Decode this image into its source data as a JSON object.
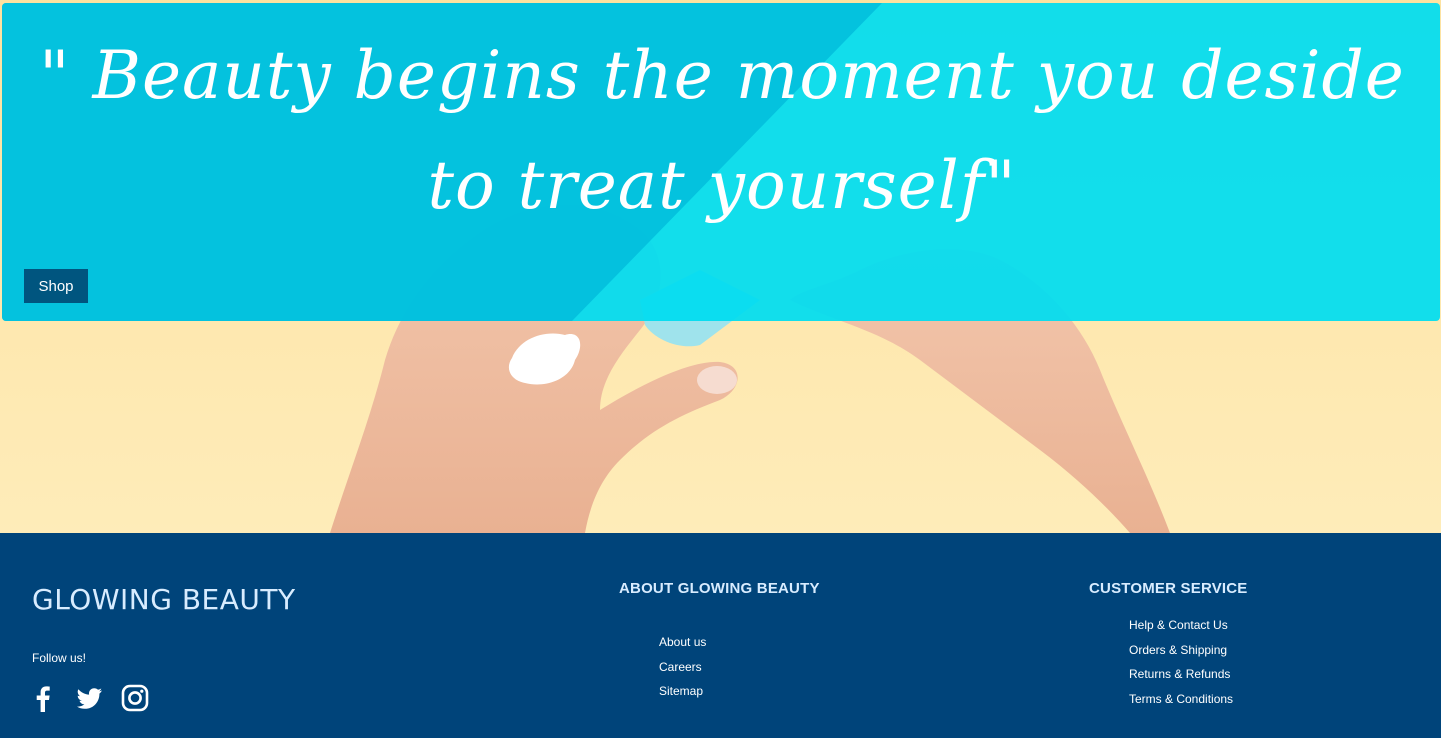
{
  "hero": {
    "quote": "\" Beauty begins the moment you deside to treat yourself\"",
    "shop_label": "Shop"
  },
  "footer": {
    "brand": "GLOWING BEAUTY",
    "follow_label": "Follow us!",
    "socials": [
      "facebook-icon",
      "twitter-icon",
      "instagram-icon"
    ],
    "about": {
      "title": "ABOUT GLOWING BEAUTY",
      "links": [
        "About us",
        "Careers",
        "Sitemap"
      ]
    },
    "service": {
      "title": "CUSTOMER SERVICE",
      "links": [
        "Help & Contact Us",
        "Orders & Shipping",
        "Returns & Refunds",
        "Terms & Conditions"
      ]
    }
  },
  "colors": {
    "overlay": "#00ddf0",
    "button": "#00557f",
    "footer": "#00447a",
    "backdrop": "#fde7a6"
  }
}
